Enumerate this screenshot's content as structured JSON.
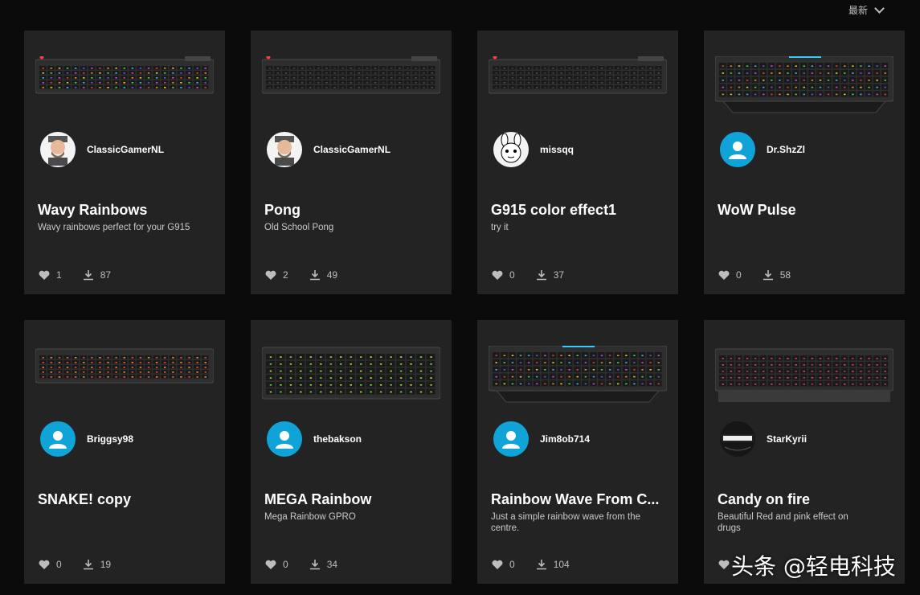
{
  "sort": {
    "label": "最新"
  },
  "cards": [
    {
      "user": "ClassicGamerNL",
      "avatar": "photo",
      "title": "Wavy Rainbows",
      "desc": "Wavy rainbows perfect for your G915",
      "likes": "1",
      "downloads": "87",
      "keyboard": "g915"
    },
    {
      "user": "ClassicGamerNL",
      "avatar": "photo",
      "title": "Pong",
      "desc": "Old School Pong",
      "likes": "2",
      "downloads": "49",
      "keyboard": "g915"
    },
    {
      "user": "missqq",
      "avatar": "bunny",
      "title": "G915 color effect1",
      "desc": "try it",
      "likes": "0",
      "downloads": "37",
      "keyboard": "g915"
    },
    {
      "user": "Dr.ShzZl",
      "avatar": "default",
      "title": "WoW Pulse",
      "desc": "",
      "likes": "0",
      "downloads": "58",
      "keyboard": "g910"
    },
    {
      "user": "Briggsy98",
      "avatar": "default",
      "title": "SNAKE! copy",
      "desc": "",
      "likes": "0",
      "downloads": "19",
      "keyboard": "g513"
    },
    {
      "user": "thebakson",
      "avatar": "default",
      "title": "MEGA Rainbow",
      "desc": "Mega Rainbow GPRO",
      "likes": "0",
      "downloads": "34",
      "keyboard": "gpro"
    },
    {
      "user": "Jim8ob714",
      "avatar": "default",
      "title": "Rainbow Wave From C...",
      "desc": "Just a simple rainbow wave from the centre.",
      "likes": "0",
      "downloads": "104",
      "keyboard": "g910"
    },
    {
      "user": "StarKyrii",
      "avatar": "dark",
      "title": "Candy on fire",
      "desc": "Beautiful Red and pink effect on drugs",
      "likes": "",
      "downloads": "",
      "keyboard": "g513rest"
    }
  ],
  "icons": {
    "like": "heart-icon",
    "download": "download-icon",
    "default_avatar": "user-icon"
  },
  "colors": {
    "card_bg": "#232323",
    "page_bg": "#0b0b0b",
    "avatar_blue": "#0fa3d8"
  },
  "watermark": "头条 @轻电科技"
}
